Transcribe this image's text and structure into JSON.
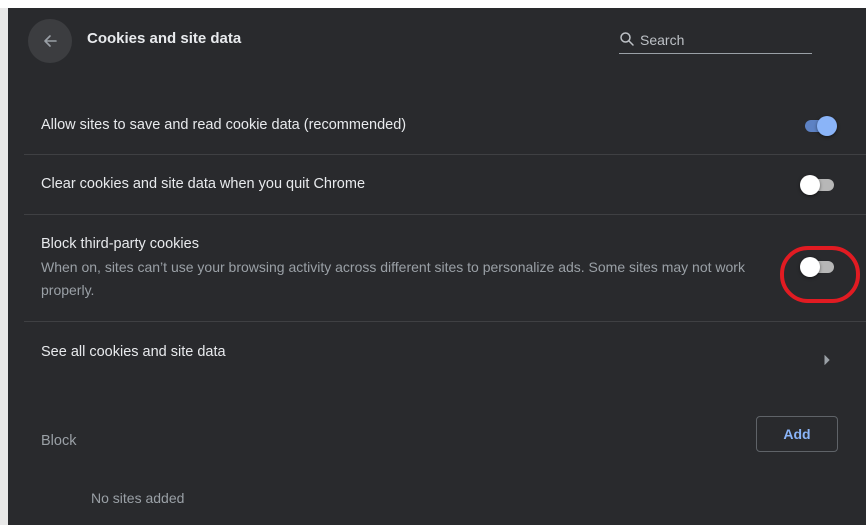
{
  "header": {
    "title": "Cookies and site data",
    "search_placeholder": "Search",
    "search_value": ""
  },
  "settings": [
    {
      "label": "Allow sites to save and read cookie data (recommended)",
      "enabled": true
    },
    {
      "label": "Clear cookies and site data when you quit Chrome",
      "enabled": false
    },
    {
      "label": "Block third-party cookies",
      "description": "When on, sites can’t use your browsing activity across different sites to personalize ads. Some sites may not work properly.",
      "enabled": false
    }
  ],
  "see_all": {
    "label": "See all cookies and site data"
  },
  "block": {
    "label": "Block",
    "add_label": "Add",
    "empty_text": "No sites added"
  },
  "colors": {
    "background": "#292a2d",
    "accent": "#8ab4f8",
    "highlight": "#e11b22"
  },
  "icons": {
    "back": "arrow-back-icon",
    "search": "search-icon",
    "chevron": "chevron-right-icon"
  }
}
